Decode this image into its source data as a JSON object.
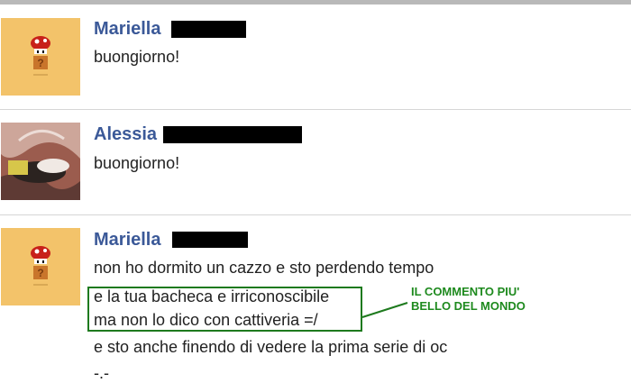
{
  "posts": [
    {
      "author": "Mariella",
      "lines": [
        "buongiorno!"
      ],
      "avatar": "mushroom-avatar"
    },
    {
      "author": "Alessia",
      "lines": [
        "buongiorno!"
      ],
      "avatar": "photo-avatar"
    },
    {
      "author": "Mariella",
      "lines": [
        "non ho dormito un cazzo e sto perdendo tempo",
        "e la tua bacheca e irriconoscibile",
        "ma non lo dico con cattiveria =/",
        "e sto anche finendo di vedere la prima serie di oc",
        "-.-"
      ],
      "avatar": "mushroom-avatar"
    }
  ],
  "annotation": {
    "line1": "IL COMMENTO PIU'",
    "line2": "BELLO DEL MONDO",
    "color": "#1e8a1e"
  },
  "colors": {
    "name": "#3b5998",
    "avatar_bg": "#f3c36a",
    "highlight": "#1e7a1e"
  }
}
